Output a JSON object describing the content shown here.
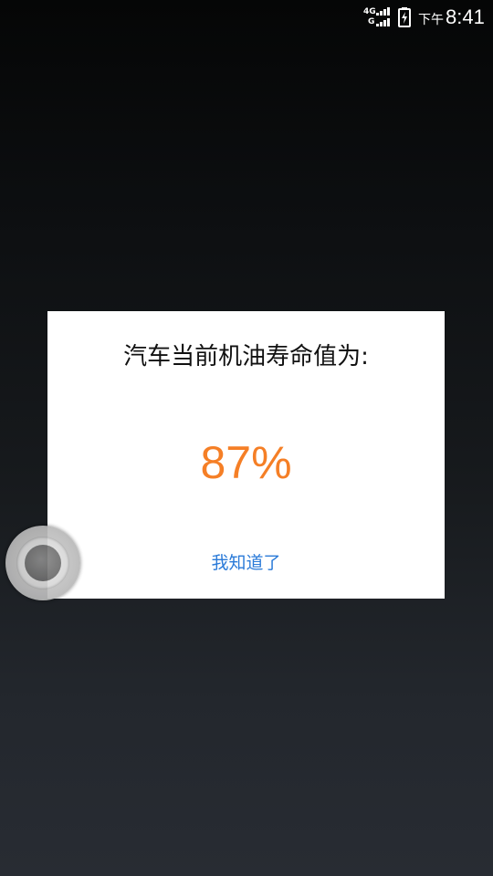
{
  "status_bar": {
    "network_top": "4G",
    "network_bottom": "G",
    "ampm": "下午",
    "time": "8:41",
    "icons": [
      "signal-icon",
      "battery-charging-icon"
    ]
  },
  "dialog": {
    "title": "汽车当前机油寿命值为:",
    "value": "87%",
    "confirm_label": "我知道了"
  },
  "colors": {
    "value": "#f57f26",
    "button": "#2a7ad8",
    "dialog_bg": "#ffffff"
  }
}
